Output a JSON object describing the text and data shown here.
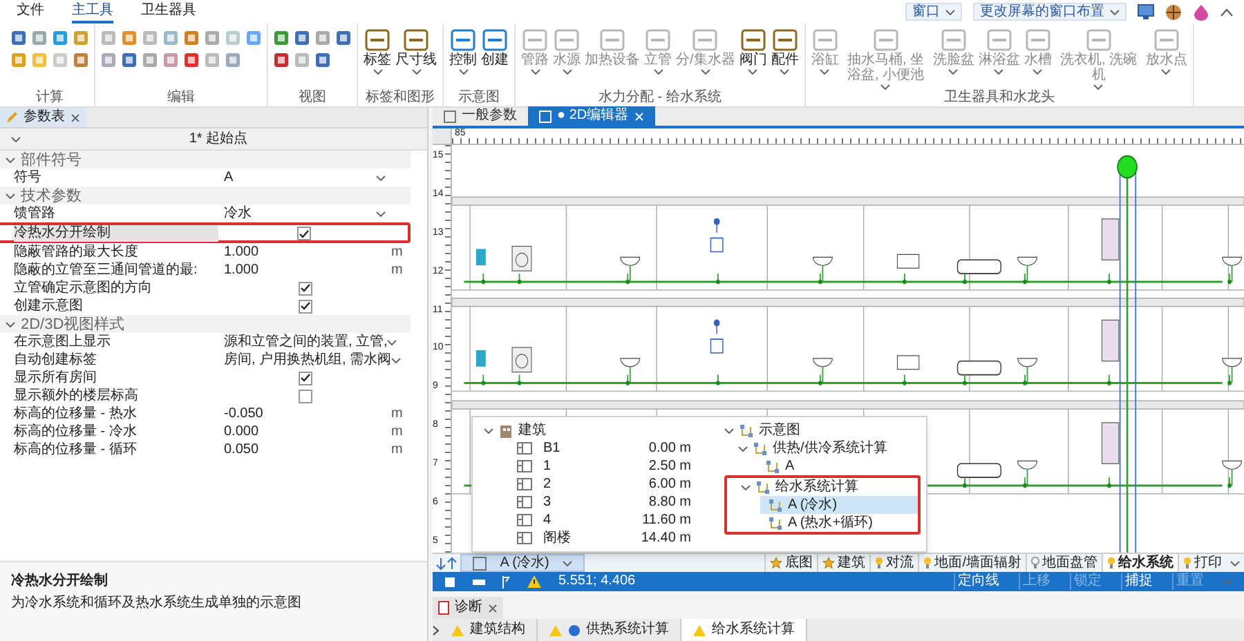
{
  "menu_tabs": [
    {
      "label": "文件",
      "selected": false
    },
    {
      "label": "主工具",
      "selected": true
    },
    {
      "label": "卫生器具",
      "selected": false
    }
  ],
  "top_right": {
    "window_dropdown": "窗口",
    "layout_dropdown": "更改屏幕的窗口布置"
  },
  "ribbon_groups": [
    {
      "title": "计算",
      "kind": "icons"
    },
    {
      "title": "编辑",
      "kind": "icons"
    },
    {
      "title": "视图",
      "kind": "icons"
    },
    {
      "title": "标签和图形",
      "kind": "buttons",
      "buttons": [
        {
          "label": "标签",
          "disabled": false,
          "dropdown": true
        },
        {
          "label": "尺寸线",
          "disabled": false,
          "dropdown": true
        }
      ]
    },
    {
      "title": "示意图",
      "kind": "buttons",
      "buttons": [
        {
          "label": "控制",
          "disabled": false,
          "dropdown": true
        },
        {
          "label": "创建",
          "disabled": false,
          "dropdown": false
        }
      ]
    },
    {
      "title": "水力分配 - 给水系统",
      "kind": "buttons",
      "buttons": [
        {
          "label": "管路",
          "disabled": true,
          "dropdown": true
        },
        {
          "label": "水源",
          "disabled": true,
          "dropdown": true
        },
        {
          "label": "加热设备",
          "disabled": true,
          "dropdown": false
        },
        {
          "label": "立管",
          "disabled": true,
          "dropdown": true
        },
        {
          "label": "分/集水器",
          "disabled": true,
          "dropdown": true
        },
        {
          "label": "阀门",
          "disabled": false,
          "dropdown": true
        },
        {
          "label": "配件",
          "disabled": false,
          "dropdown": true
        }
      ]
    },
    {
      "title": "卫生器具和水龙头",
      "kind": "buttons",
      "buttons": [
        {
          "label": "浴缸",
          "disabled": true,
          "dropdown": true
        },
        {
          "label": "抽水马桶, 坐浴盆, 小便池",
          "disabled": true,
          "dropdown": true
        },
        {
          "label": "洗脸盆",
          "disabled": true,
          "dropdown": true
        },
        {
          "label": "淋浴盆",
          "disabled": true,
          "dropdown": true
        },
        {
          "label": "水槽",
          "disabled": true,
          "dropdown": true
        },
        {
          "label": "洗衣机, 洗碗机",
          "disabled": true,
          "dropdown": true
        },
        {
          "label": "放水点",
          "disabled": true,
          "dropdown": true
        }
      ]
    }
  ],
  "properties_panel": {
    "tab": "参数表",
    "header": "1* 起始点",
    "sections": [
      {
        "title": "部件符号",
        "expanded": true,
        "rows": [
          {
            "kind": "dropdown",
            "label": "符号",
            "value": "A",
            "highlighted": false
          }
        ]
      },
      {
        "title": "技术参数",
        "expanded": true,
        "rows": [
          {
            "kind": "dropdown",
            "label": "馈管路",
            "value": "冷水",
            "highlighted": false
          },
          {
            "kind": "checkbox",
            "label": "冷热水分开绘制",
            "checked": true,
            "highlighted": true
          },
          {
            "kind": "number",
            "label": "隐蔽管路的最大长度",
            "value": "1.000",
            "unit": "m",
            "highlighted": false
          },
          {
            "kind": "number",
            "label": "隐蔽的立管至三通间管道的最:",
            "value": "1.000",
            "unit": "m",
            "highlighted": false
          },
          {
            "kind": "checkbox",
            "label": "立管确定示意图的方向",
            "checked": true,
            "highlighted": false
          },
          {
            "kind": "checkbox",
            "label": "创建示意图",
            "checked": true,
            "highlighted": false
          }
        ]
      },
      {
        "title": "2D/3D视图样式",
        "expanded": true,
        "rows": [
          {
            "kind": "dropdown",
            "label": "在示意图上显示",
            "value": "源和立管之间的装置, 立管,",
            "highlighted": false
          },
          {
            "kind": "dropdown",
            "label": "自动创建标签",
            "value": "房间, 户用换热机组, 需水阀",
            "highlighted": false
          },
          {
            "kind": "checkbox",
            "label": "显示所有房间",
            "checked": true,
            "highlighted": false
          },
          {
            "kind": "checkbox",
            "label": "显示额外的楼层标高",
            "checked": false,
            "highlighted": false
          },
          {
            "kind": "number",
            "label": "标高的位移量 - 热水",
            "value": "-0.050",
            "unit": "m",
            "highlighted": false
          },
          {
            "kind": "number",
            "label": "标高的位移量 - 冷水",
            "value": "0.000",
            "unit": "m",
            "highlighted": false
          },
          {
            "kind": "number",
            "label": "标高的位移量 - 循环",
            "value": "0.050",
            "unit": "m",
            "highlighted": false
          }
        ]
      }
    ],
    "description": {
      "title": "冷热水分开绘制",
      "text": "为冷水系统和循环及热水系统生成单独的示意图"
    }
  },
  "editor_tabs": [
    {
      "label": "一般参数",
      "selected": false
    },
    {
      "label": "● 2D编辑器",
      "selected": true,
      "closable": true
    }
  ],
  "ruler": {
    "top_label": "85",
    "side_labels": [
      "15",
      "14",
      "13",
      "12",
      "11",
      "10",
      "9",
      "8",
      "7",
      "6",
      "5"
    ]
  },
  "tree_popup": {
    "building": {
      "label": "建筑",
      "expanded": true,
      "children": [
        {
          "label": "B1",
          "elevation": "0.00 m",
          "selected": false
        },
        {
          "label": "1",
          "elevation": "2.50 m",
          "selected": false
        },
        {
          "label": "2",
          "elevation": "6.00 m",
          "selected": false
        },
        {
          "label": "3",
          "elevation": "8.80 m",
          "selected": false
        },
        {
          "label": "4",
          "elevation": "11.60 m",
          "selected": false
        },
        {
          "label": "阁楼",
          "elevation": "14.40 m",
          "selected": false
        }
      ]
    },
    "schematics": {
      "label": "示意图",
      "expanded": true,
      "children": [
        {
          "label": "供热/供冷系统计算",
          "expanded": true,
          "highlighted": false,
          "children": [
            {
              "label": "A",
              "selected": false
            }
          ]
        },
        {
          "label": "给水系统计算",
          "expanded": true,
          "highlighted": true,
          "children": [
            {
              "label": "A (冷水)",
              "selected": true
            },
            {
              "label": "A (热水+循环)",
              "selected": false
            }
          ]
        }
      ]
    }
  },
  "layer_bar": {
    "current": "A (冷水)",
    "layers": [
      {
        "label": "底图",
        "kind": "star",
        "active": false
      },
      {
        "label": "建筑",
        "kind": "star",
        "active": false
      },
      {
        "label": "对流",
        "kind": "bulb",
        "active": false
      },
      {
        "label": "地面/墙面辐射",
        "kind": "bulb",
        "active": false
      },
      {
        "label": "地面盘管",
        "kind": "bulb-off",
        "active": false
      },
      {
        "label": "给水系统",
        "kind": "bulb",
        "active": true
      },
      {
        "label": "打印",
        "kind": "bulb",
        "active": false
      }
    ]
  },
  "status_bar": {
    "coordinates": "5.551; 4.406",
    "items": [
      {
        "label": "定向线",
        "enabled": true
      },
      {
        "label": "上移",
        "enabled": false
      },
      {
        "label": "锁定",
        "enabled": false
      },
      {
        "label": "捕捉",
        "enabled": true
      },
      {
        "label": "重置",
        "enabled": false
      }
    ]
  },
  "diagnostics": {
    "tab": "诊断",
    "tabs": [
      {
        "label": "建筑结构",
        "kind": "warning",
        "selected": false
      },
      {
        "label": "供热系统计算",
        "kind": "warning-globe",
        "selected": false
      },
      {
        "label": "给水系统计算",
        "kind": "warning",
        "selected": true
      }
    ]
  }
}
